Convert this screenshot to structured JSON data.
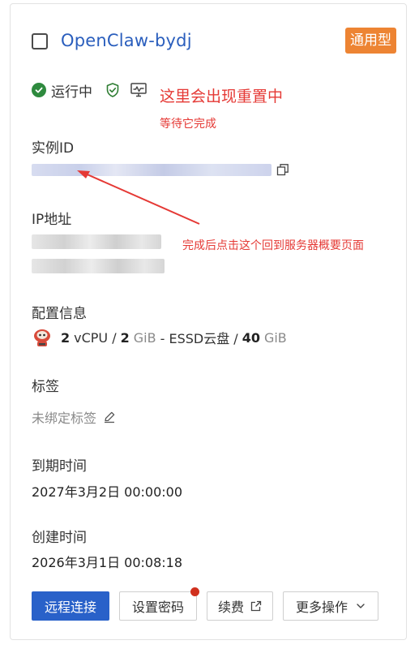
{
  "instance": {
    "name": "OpenClaw-bydj",
    "type_badge": "通用型"
  },
  "status": {
    "text": "运行中"
  },
  "annotations": {
    "reset_note": "这里会出现重置中",
    "wait_note": "等待它完成",
    "back_note": "完成后点击这个回到服务器概要页面"
  },
  "fields": {
    "instance_id_label": "实例ID",
    "ip_label": "IP地址",
    "config_label": "配置信息",
    "tags_label": "标签",
    "expire_label": "到期时间",
    "expire_value": "2027年3月2日 00:00:00",
    "created_label": "创建时间",
    "created_value": "2026年3月1日 00:08:18"
  },
  "config": {
    "vcpu_count": "2",
    "vcpu_unit": "vCPU /",
    "ram_count": "2",
    "ram_unit": "GiB",
    "disk_sep": "- ESSD云盘 /",
    "disk_size": "40",
    "disk_unit": "GiB"
  },
  "tags": {
    "unbound_text": "未绑定标签"
  },
  "buttons": {
    "remote_connect": "远程连接",
    "set_password": "设置密码",
    "renew": "续费",
    "more_actions": "更多操作"
  },
  "colors": {
    "accent": "#2961c9",
    "badge": "#ed8433",
    "status_running": "#2e8a3e",
    "annotation": "#e53935"
  },
  "icons": {
    "status": "check-circle-icon",
    "security": "shield-check-icon",
    "monitor": "monitor-icon",
    "copy": "copy-icon",
    "os": "os-logo-icon",
    "edit": "pencil-icon",
    "external": "external-link-icon",
    "dropdown": "chevron-down-icon"
  }
}
